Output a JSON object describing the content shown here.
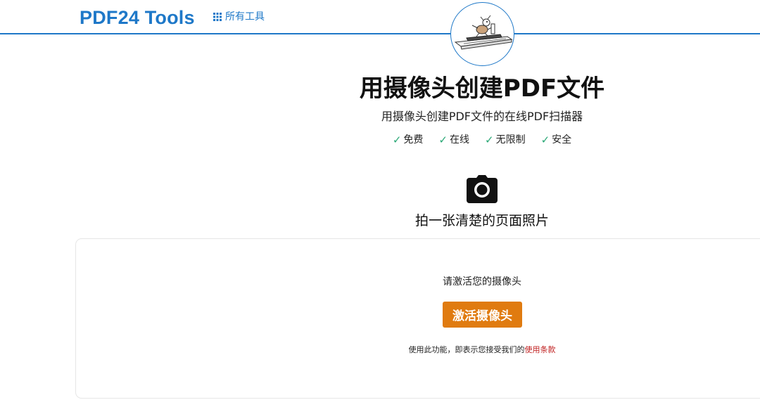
{
  "header": {
    "brand": "PDF24 Tools",
    "all_tools_label": "所有工具",
    "accent_color": "#1e78c8"
  },
  "logo": {
    "icon": "scanner-mascot-icon"
  },
  "hero": {
    "title": "用摄像头创建PDF文件",
    "subtitle": "用摄像头创建PDF文件的在线PDF扫描器",
    "features": [
      {
        "check": "✓",
        "label": "免费"
      },
      {
        "check": "✓",
        "label": "在线"
      },
      {
        "check": "✓",
        "label": "无限制"
      },
      {
        "check": "✓",
        "label": "安全"
      }
    ],
    "camera_icon": "camera-icon",
    "photo_hint": "拍一张清楚的页面照片"
  },
  "card": {
    "prompt": "请激活您的摄像头",
    "activate_button": "激活摄像头",
    "button_color": "#e07b10",
    "terms_prefix": "使用此功能，即表示您接受我们的",
    "terms_link": "使用条款"
  }
}
